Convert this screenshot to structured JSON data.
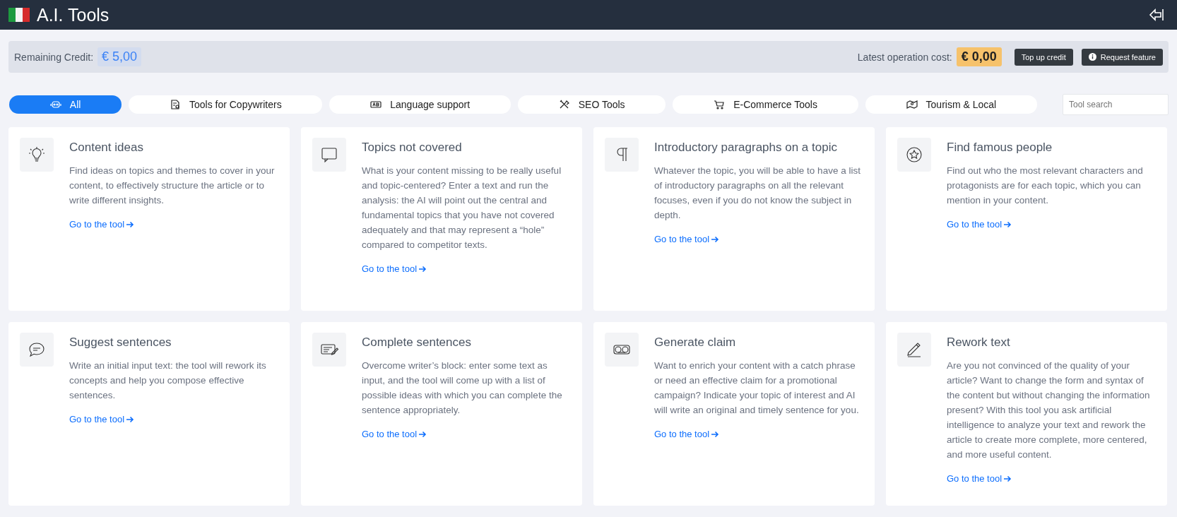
{
  "header": {
    "title": "A.I. Tools"
  },
  "credit_bar": {
    "remaining_label": "Remaining Credit:",
    "remaining_value": "€ 5,00",
    "cost_label": "Latest operation cost:",
    "cost_value": "€ 0,00",
    "buttons": [
      "Top up credit",
      "Request feature"
    ]
  },
  "categories": [
    {
      "label": "All",
      "selected": true
    },
    {
      "label": "Tools for Copywriters",
      "selected": false
    },
    {
      "label": "Language support",
      "selected": false
    },
    {
      "label": "SEO Tools",
      "selected": false
    },
    {
      "label": "E-Commerce Tools",
      "selected": false
    },
    {
      "label": "Tourism & Local",
      "selected": false
    }
  ],
  "search": {
    "placeholder": "Tool search"
  },
  "tools": [
    {
      "title": "Content ideas",
      "description": "Find ideas on topics and themes to cover in your content, to effectively structure the article or to write different insights.",
      "link": "Go to the tool"
    },
    {
      "title": "Topics not covered",
      "description": "What is your content missing to be really useful and topic-centered? Enter a text and run the analysis: the AI will point out the central and fundamental topics that you have not covered adequately and that may represent a “hole” compared to competitor texts.",
      "link": "Go to the tool"
    },
    {
      "title": "Introductory paragraphs on a topic",
      "description": "Whatever the topic, you will be able to have a list of introductory paragraphs on all the relevant focuses, even if you do not know the subject in depth.",
      "link": "Go to the tool"
    },
    {
      "title": "Find famous people",
      "description": "Find out who the most relevant characters and protagonists are for each topic, which you can mention in your content.",
      "link": "Go to the tool"
    },
    {
      "title": "Suggest sentences",
      "description": "Write an initial input text: the tool will rework its concepts and help you compose effective sentences.",
      "link": "Go to the tool"
    },
    {
      "title": "Complete sentences",
      "description": "Overcome writer’s block: enter some text as input, and the tool will come up with a list of possible ideas with which you can complete the sentence appropriately.",
      "link": "Go to the tool"
    },
    {
      "title": "Generate claim",
      "description": "Want to enrich your content with a catch phrase or need an effective claim for a promotional campaign? Indicate your topic of interest and AI will write an original and timely sentence for you.",
      "link": "Go to the tool"
    },
    {
      "title": "Rework text",
      "description": "Are you not convinced of the quality of your article? Want to change the form and syntax of the content but without changing the information present? With this tool you ask artificial intelligence to analyze your text and rework the article to create more complete, more centered, and more useful content.",
      "link": "Go to the tool"
    }
  ]
}
